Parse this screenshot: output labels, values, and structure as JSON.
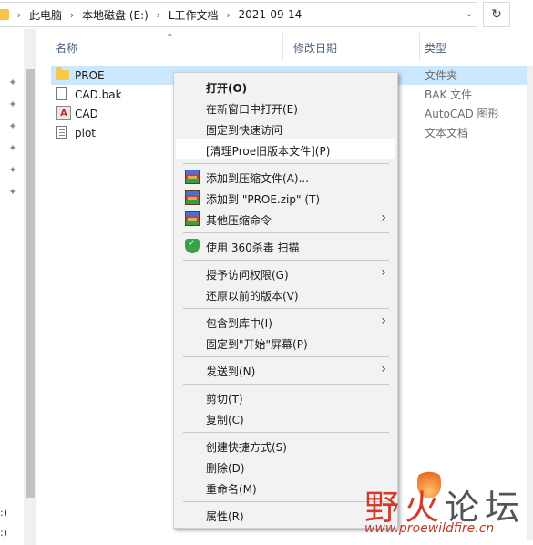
{
  "address": {
    "crumbs": [
      "此电脑",
      "本地磁盘 (E:)",
      "L工作文档",
      "2021-09-14"
    ],
    "separator_icon": "chevron-right-icon",
    "dropdown_icon": "chevron-down-icon",
    "refresh_icon": "refresh-icon"
  },
  "left_pane": {
    "pin_icon": "pin-icon",
    "drive_labels": [
      ":)",
      ":)"
    ]
  },
  "columns": {
    "name": "名称",
    "modified": "修改日期",
    "type": "类型",
    "sort_icon": "sort-up-icon"
  },
  "files": [
    {
      "name": "PROE",
      "type": "文件夹",
      "icon": "folder-icon"
    },
    {
      "name": "CAD.bak",
      "type": "BAK 文件",
      "icon": "file-icon"
    },
    {
      "name": "CAD",
      "type": "AutoCAD 图形",
      "icon": "autocad-icon"
    },
    {
      "name": "plot",
      "type": "文本文档",
      "icon": "text-file-icon"
    }
  ],
  "menu": {
    "open": "打开(O)",
    "open_new_window": "在新窗口中打开(E)",
    "pin_quick_access": "固定到快速访问",
    "clean_proe": "[清理Proe旧版本文件](P)",
    "add_to_archive": "添加到压缩文件(A)...",
    "add_to_zip": "添加到 \"PROE.zip\" (T)",
    "other_compress": "其他压缩命令",
    "scan_360": "使用 360杀毒 扫描",
    "grant_access": "授予访问权限(G)",
    "restore_previous": "还原以前的版本(V)",
    "include_library": "包含到库中(I)",
    "pin_start": "固定到\"开始\"屏幕(P)",
    "send_to": "发送到(N)",
    "cut": "剪切(T)",
    "copy": "复制(C)",
    "create_shortcut": "创建快捷方式(S)",
    "delete": "删除(D)",
    "rename": "重命名(M)",
    "properties": "属性(R)",
    "submenu_arrow": "›",
    "archive_icon": "winrar-icon",
    "shield_icon": "360-shield-icon"
  },
  "watermark": {
    "title_part1": "野火",
    "title_part2": "论坛",
    "url": "www.proewildfire.cn"
  }
}
